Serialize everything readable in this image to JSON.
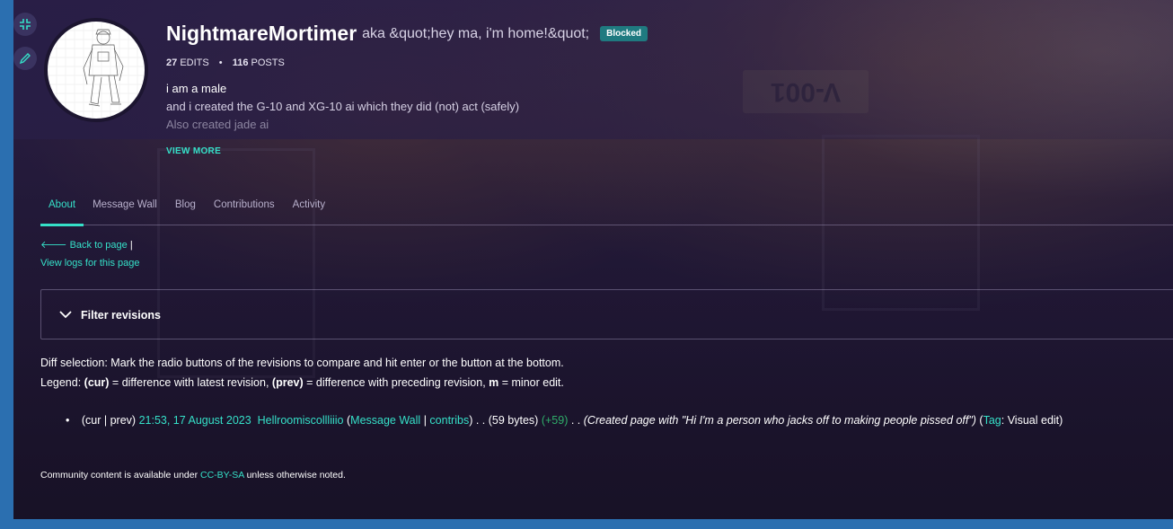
{
  "profile": {
    "username": "NightmareMortimer",
    "aka": "aka &quot;hey ma, i'm home!&quot;",
    "badge": "Blocked",
    "edits_count": "27",
    "edits_label": "EDITS",
    "posts_count": "116",
    "posts_label": "POSTS",
    "bio_line1": "i am a male",
    "bio_line2": "and i created the G-10 and XG-10 ai which they did (not) act (safely)",
    "bio_line3": "Also created jade ai",
    "view_more": "VIEW MORE"
  },
  "tabs": [
    "About",
    "Message Wall",
    "Blog",
    "Contributions",
    "Activity"
  ],
  "links": {
    "back": "Back to page",
    "separator": "|",
    "logs": "View logs for this page"
  },
  "filter": {
    "label": "Filter revisions"
  },
  "diff": {
    "line1": "Diff selection: Mark the radio buttons of the revisions to compare and hit enter or the button at the bottom.",
    "legend_prefix": "Legend: ",
    "cur": "(cur)",
    "cur_text": " = difference with latest revision, ",
    "prev": "(prev)",
    "prev_text": " = difference with preceding revision, ",
    "m": "m",
    "m_text": " = minor edit."
  },
  "revision": {
    "curprev": "(cur | prev)",
    "timestamp": "21:53, 17 August 2023",
    "user": "Hellroomiscollliiio",
    "open": "(",
    "wall": "Message Wall",
    "sep": "|",
    "contribs": "contribs",
    "close": ")",
    "dots1": ". .",
    "size": "(59 bytes)",
    "delta": "(+59)",
    "dots2": ". .",
    "summary": "(Created page with \"Hi I'm a person who jacks off to making people pissed off\")",
    "tag_open": "(",
    "tag": "Tag",
    "tag_value": ": Visual edit)"
  },
  "footer": {
    "prefix": "Community content is available under ",
    "license": "CC-BY-SA",
    "suffix": " unless otherwise noted."
  },
  "colors": {
    "accent": "#35e0c8",
    "badge": "#1f7a80",
    "positive": "#2fae6a",
    "background": "#2a1f45"
  },
  "icons": [
    "collapse-icon",
    "edit-pencil-icon",
    "arrow-left-icon",
    "chevron-down-icon"
  ]
}
